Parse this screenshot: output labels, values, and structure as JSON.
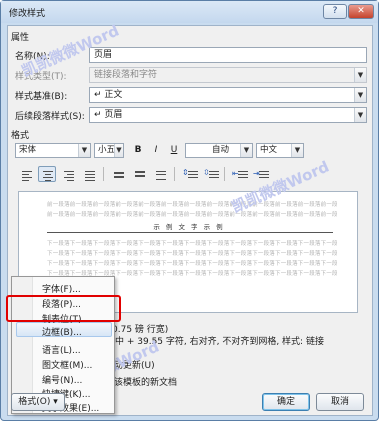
{
  "window": {
    "title": "修改样式",
    "help": "?",
    "close": "✕"
  },
  "properties": {
    "section": "属性",
    "name_label": "名称(N):",
    "name_value": "页眉",
    "type_label": "样式类型(T):",
    "type_value": "链接段落和字符",
    "base_label": "样式基准(B):",
    "base_value": "正文",
    "base_icon": "↵",
    "next_label": "后续段落样式(S):",
    "next_value": "页眉",
    "next_icon": "↵"
  },
  "format": {
    "section": "格式",
    "font": "宋体",
    "size": "小五",
    "bold": "B",
    "italic": "I",
    "underline": "U",
    "color": "自动",
    "lang": "中文"
  },
  "preview": {
    "prev_text": "前一段落前一段落前一段落前一段落前一段落前一段落前一段落前一段落前一段落前一段落前一段落前一段落前一段落前一段落",
    "sample": "示 例 文 字 示 例",
    "next_text": "下一段落下一段落下一段落下一段落下一段落下一段落下一段落下一段落下一段落下一段落下一段落下一段落下一段落下一段落"
  },
  "description": {
    "line1": "0.75 磅 行宽)",
    "line2": "居中 + 39.55 字符, 右对齐, 不对齐到网格, 样式: 链接",
    "add_auto": "动更新(U)",
    "template": "该模板的新文档"
  },
  "menu": {
    "items": [
      "字体(F)...",
      "段落(P)...",
      "制表位(T)...",
      "边框(B)...",
      "语言(L)...",
      "图文框(M)...",
      "编号(N)...",
      "快捷键(K)...",
      "文字效果(E)..."
    ]
  },
  "buttons": {
    "format": "格式(O) ▾",
    "ok": "确定",
    "cancel": "取消"
  },
  "watermark": "凯凯微微Word",
  "colors": {
    "highlight": "#e10000",
    "titlebar": "#c9dcef",
    "dialog_body": "#f0f0f0"
  }
}
